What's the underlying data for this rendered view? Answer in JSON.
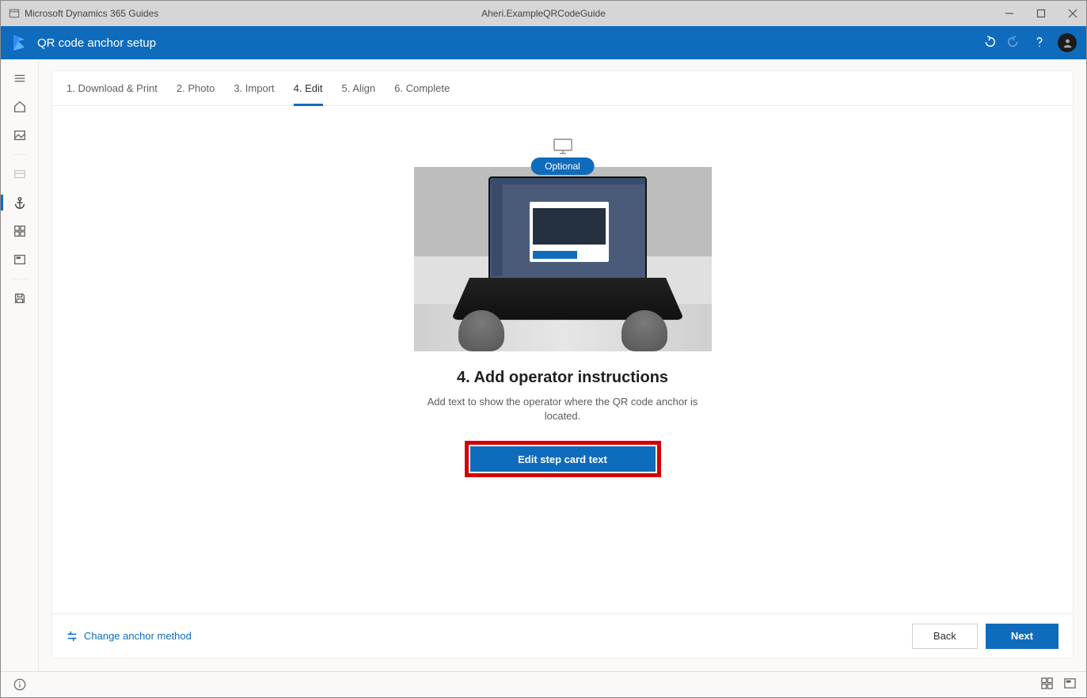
{
  "titlebar": {
    "app_name": "Microsoft Dynamics 365 Guides",
    "document_name": "Aheri.ExampleQRCodeGuide"
  },
  "header": {
    "title": "QR code anchor setup"
  },
  "tabs": [
    {
      "label": "1. Download & Print",
      "active": false
    },
    {
      "label": "2. Photo",
      "active": false
    },
    {
      "label": "3. Import",
      "active": false
    },
    {
      "label": "4. Edit",
      "active": true
    },
    {
      "label": "5. Align",
      "active": false
    },
    {
      "label": "6. Complete",
      "active": false
    }
  ],
  "stage": {
    "optional_badge": "Optional",
    "title": "4. Add operator instructions",
    "description": "Add text to show the operator where the QR code anchor is located.",
    "cta_label": "Edit step card text"
  },
  "footer": {
    "change_method": "Change anchor method",
    "back": "Back",
    "next": "Next"
  }
}
